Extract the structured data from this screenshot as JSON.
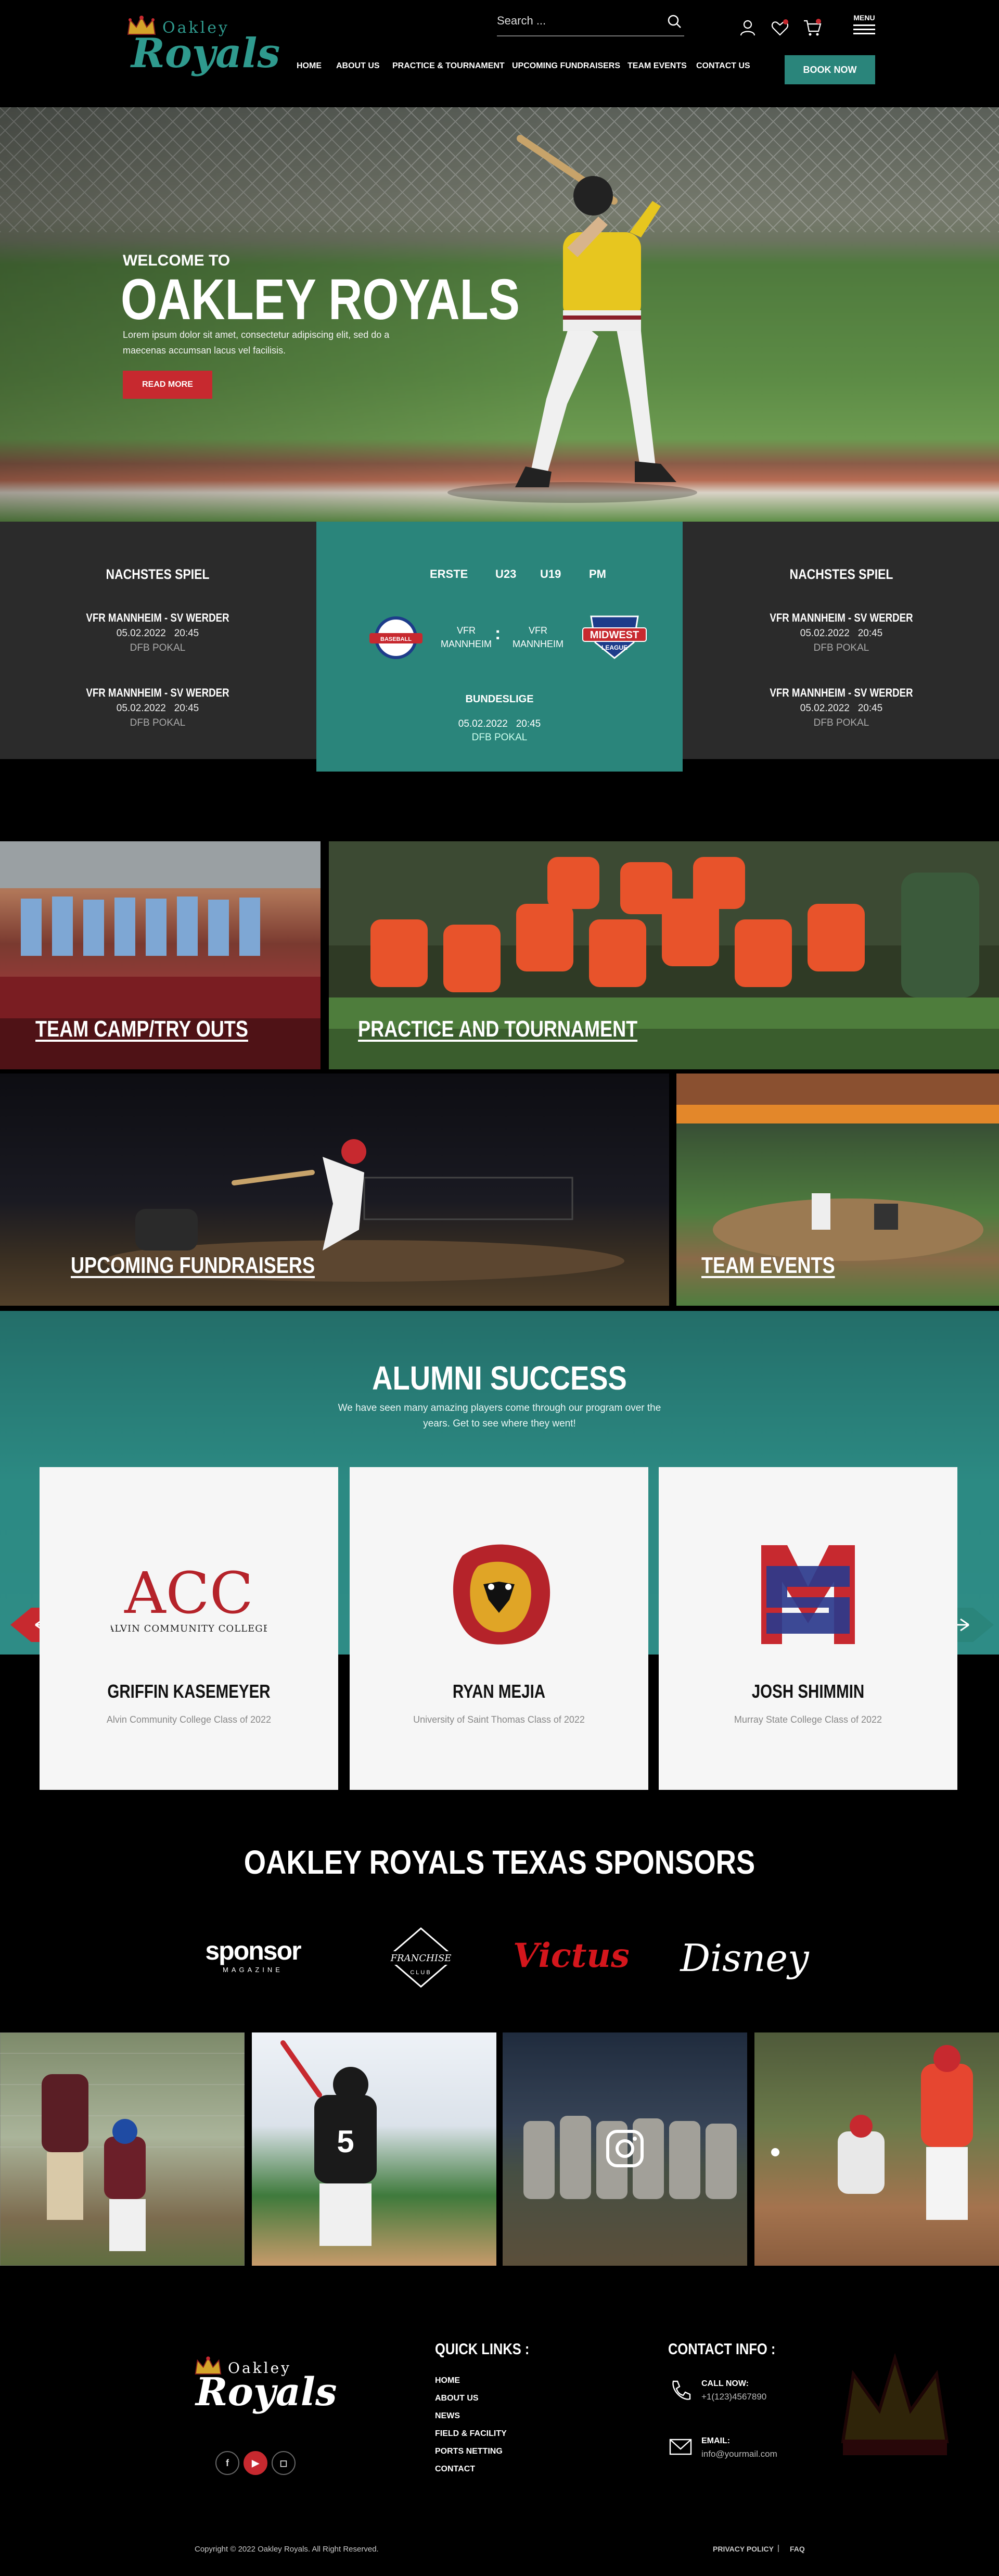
{
  "brand": {
    "logo_top": "Oakley",
    "logo_main": "Royals",
    "accent_color": "#2a857b",
    "red_color": "#c7292f"
  },
  "header": {
    "search_placeholder": "Search ...",
    "menu_label": "MENU",
    "nav": [
      "HOME",
      "ABOUT US",
      "PRACTICE & TOURNAMENT",
      "UPCOMING FUNDRAISERS",
      "TEAM EVENTS",
      "CONTACT US"
    ],
    "book_label": "BOOK NOW",
    "icons": [
      "search-icon",
      "user-icon",
      "heart-icon",
      "cart-icon",
      "hamburger-icon"
    ]
  },
  "hero": {
    "welcome": "WELCOME TO",
    "title": "OAKLEY ROYALS",
    "text": "Lorem ipsum dolor sit amet, consectetur adipiscing elit, sed do a maecenas accumsan lacus vel facilisis.",
    "button": "READ MORE"
  },
  "matches": {
    "left": {
      "heading": "NACHSTES SPIEL",
      "fixtures": [
        {
          "teams": "VFR MANNHEIM - SV WERDER",
          "date": "05.02.2022",
          "time": "20:45",
          "cup": "DFB POKAL"
        },
        {
          "teams": "VFR MANNHEIM - SV WERDER",
          "date": "05.02.2022",
          "time": "20:45",
          "cup": "DFB POKAL"
        }
      ]
    },
    "right": {
      "heading": "NACHSTES SPIEL",
      "fixtures": [
        {
          "teams": "VFR MANNHEIM - SV WERDER",
          "date": "05.02.2022",
          "time": "20:45",
          "cup": "DFB POKAL"
        },
        {
          "teams": "VFR MANNHEIM - SV WERDER",
          "date": "05.02.2022",
          "time": "20:45",
          "cup": "DFB POKAL"
        }
      ]
    },
    "center": {
      "tabs": [
        "ERSTE",
        "U23",
        "U19",
        "PM"
      ],
      "team_a": "VFR\nMANNHEIM",
      "team_a_line1": "VFR",
      "team_a_line2": "MANNHEIM",
      "separator": ":",
      "team_b_line1": "VFR",
      "team_b_line2": "MANNHEIM",
      "league": "BUNDESLIGE",
      "date": "05.02.2022",
      "time": "20:45",
      "cup": "DFB POKAL",
      "team_a_badge": "BASEBALL",
      "team_b_badge_top": "MIDWEST",
      "team_b_badge_bottom": "LEAGUE"
    }
  },
  "programs": [
    {
      "label": "TEAM CAMP/TRY OUTS"
    },
    {
      "label": "PRACTICE AND TOURNAMENT"
    },
    {
      "label": "UPCOMING FUNDRAISERS"
    },
    {
      "label": "TEAM EVENTS"
    }
  ],
  "alumni": {
    "title": "ALUMNI SUCCESS",
    "subtitle": "We have seen many amazing players come through our program over the years. Get to see where they went!",
    "cards": [
      {
        "name": "GRIFFIN KASEMEYER",
        "school": "Alvin Community College Class of 2022",
        "logo_text": "ACC",
        "logo_sub": "ALVIN COMMUNITY COLLEGE"
      },
      {
        "name": "RYAN MEJIA",
        "school": "University of Saint Thomas Class of 2022"
      },
      {
        "name": "JOSH SHIMMIN",
        "school": "Murray State College Class of 2022"
      }
    ]
  },
  "sponsors": {
    "title": "OAKLEY ROYALS TEXAS SPONSORS",
    "items": [
      {
        "main": "sponsor",
        "sub": "MAGAZINE"
      },
      {
        "main": "FRANCHISE",
        "sub": "CLUB"
      },
      {
        "main": "Victus"
      },
      {
        "main": "Disney"
      }
    ]
  },
  "footer": {
    "quick_links_title": "QUICK LINKS :",
    "quick_links": [
      "HOME",
      "ABOUT US",
      "NEWS",
      "FIELD & FACILITY",
      "PORTS NETTING",
      "CONTACT"
    ],
    "contact_title": "CONTACT INFO :",
    "call_label": "CALL NOW:",
    "call_value": "+1(123)4567890",
    "email_label": "EMAIL:",
    "email_value": "info@yourmail.com",
    "social": [
      "facebook-icon",
      "youtube-icon",
      "instagram-icon"
    ],
    "copyright": "Copyright © 2022 Oakley Royals. All Right Reserved.",
    "privacy": "PRIVACY POLICY",
    "sep": "|",
    "faq": "FAQ"
  }
}
